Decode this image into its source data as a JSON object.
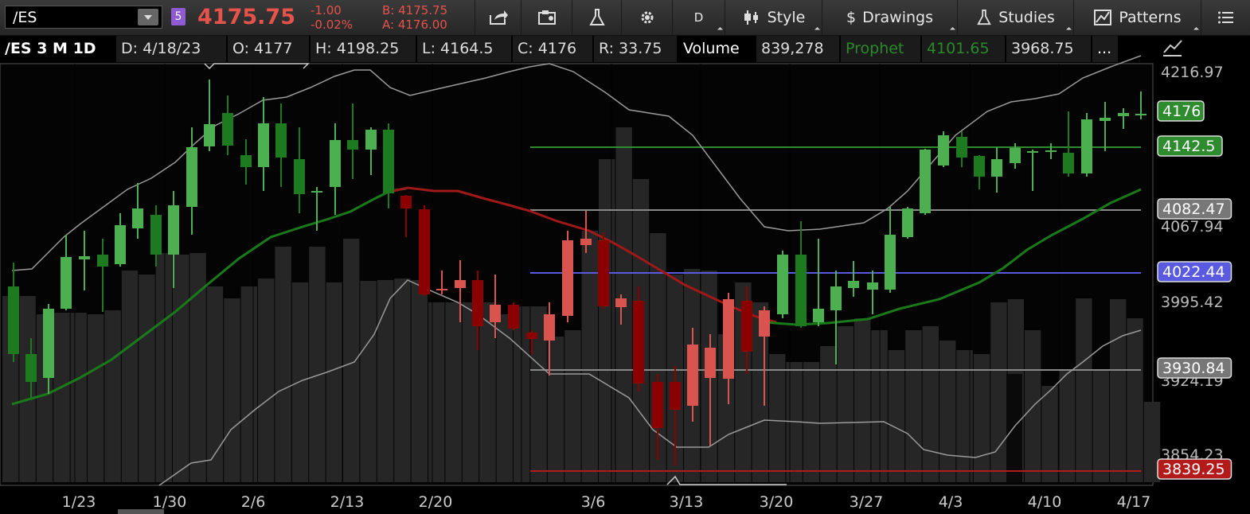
{
  "toolbar": {
    "symbol": "/ES",
    "link_badge": "5",
    "last_price": "4175.75",
    "net_change": "-1.00",
    "pct_change": "-0.02%",
    "bid": "B: 4175.75",
    "ask": "A: 4176.00",
    "aggregation_label": "D",
    "style_label": "Style",
    "drawings_label": "Drawings",
    "studies_label": "Studies",
    "patterns_label": "Patterns",
    "icons": [
      "share-icon",
      "save-icon",
      "flask-icon",
      "gear-icon",
      "menu-icon"
    ]
  },
  "infobar": {
    "symbol_period": "/ES 3 M 1D",
    "date": "D: 4/18/23",
    "open": "O: 4177",
    "high": "H: 4198.25",
    "low": "L: 4164.5",
    "close": "C: 4176",
    "range": "R: 33.75",
    "volume_label": "Volume",
    "volume_value": "839,278",
    "prophet_label": "Prophet",
    "prophet_value1": "4101.65",
    "prophet_value2": "3968.75",
    "more": "..."
  },
  "price_axis": {
    "plain_labels": [
      "4216.97",
      "4067.94",
      "3995.42",
      "3924.19",
      "3854.23"
    ],
    "boxed_labels": [
      {
        "text": "4176",
        "color": "#2e8b2e"
      },
      {
        "text": "4142.5",
        "color": "#2e8b2e"
      },
      {
        "text": "4082.47",
        "color": "#777777"
      },
      {
        "text": "4022.44",
        "color": "#5a5ae0"
      },
      {
        "text": "3930.84",
        "color": "#777777"
      },
      {
        "text": "3839.25",
        "color": "#b31b1b"
      }
    ]
  },
  "time_axis": [
    "1/23",
    "1/30",
    "2/6",
    "2/13",
    "2/20",
    "3/6",
    "3/13",
    "3/20",
    "3/27",
    "4/3",
    "4/10",
    "4/17"
  ],
  "colors": {
    "up": "#4caf50",
    "up_dark": "#1e7a1e",
    "down": "#8b0000",
    "down_light": "#d9534f",
    "ma_red": "#a01818",
    "ma_green": "#1a7a1a",
    "volume": "#262626",
    "level_green": "#2e8b2e",
    "level_blue": "#5a5ae0",
    "level_gray": "#888888",
    "level_red": "#b31b1b"
  }
}
